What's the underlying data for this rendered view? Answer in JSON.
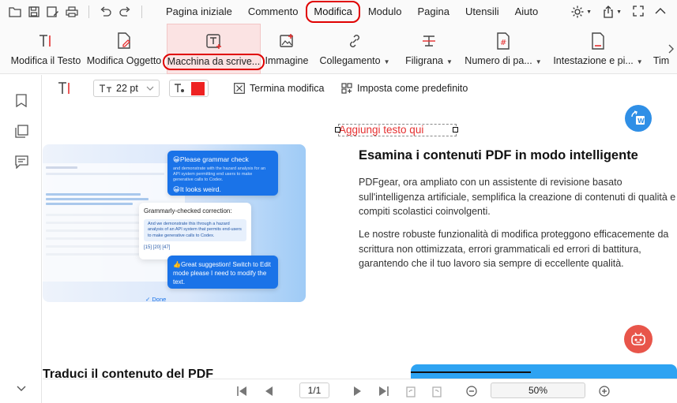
{
  "menu": {
    "items": [
      "Pagina iniziale",
      "Commento",
      "Modifica",
      "Modulo",
      "Pagina",
      "Utensili",
      "Aiuto"
    ],
    "active_index": 2
  },
  "ribbon": {
    "tools": [
      {
        "label": "Modifica il Testo",
        "icon": "edit-text-icon"
      },
      {
        "label": "Modifica Oggetto",
        "icon": "edit-object-icon"
      },
      {
        "label": "Macchina da scrive...",
        "icon": "typewriter-icon"
      },
      {
        "label": "Immagine",
        "icon": "image-icon"
      },
      {
        "label": "Collegamento",
        "icon": "link-icon",
        "caret": true
      },
      {
        "label": "Filigrana",
        "icon": "watermark-icon",
        "caret": true
      },
      {
        "label": "Numero di pa...",
        "icon": "page-number-icon",
        "caret": true
      },
      {
        "label": "Intestazione e pi...",
        "icon": "header-footer-icon",
        "caret": true
      },
      {
        "label": "Tim",
        "icon": "more-icon"
      }
    ]
  },
  "subbar": {
    "font_size": "22 pt",
    "text_color": "#ee2222",
    "finish_label": "Termina modifica",
    "default_label": "Imposta come predefinito"
  },
  "document": {
    "add_text_placeholder": "Aggiungi testo qui",
    "heading": "Esamina i contenuti PDF in modo intelligente",
    "para1": "PDFgear, ora ampliato con un assistente di revisione basato sull'intelligenza artificiale, semplifica la creazione di contenuti di qualità e compiti scolastici coinvolgenti.",
    "para2": "Le nostre robuste funzionalità di modifica proteggono efficacemente da scrittura non ottimizzata, errori grammaticali ed errori di battitura, garantendo che il tuo lavoro sia sempre di eccellente qualità.",
    "bottom_heading": "Traduci il contenuto del PDF",
    "hero": {
      "bubble1_title": "😀Please grammar check",
      "bubble1_small": "and demonstrate with the hazard analysis for an API system permitting end users to make generative calls to Codex.",
      "bubble1_footer": "😀It looks weird.",
      "card_title": "Grammarly-checked correction:",
      "card_text": "And we demonstrate this through a hazard analysis of an API system that permits end-users to make generative calls to Codex.",
      "card_refs": "[15] [20] [47]",
      "bubble2": "👍Great suggestion! Switch to Edit mode please I need to modify the text.",
      "done": "✓ Done"
    }
  },
  "navbar": {
    "page": "1/1",
    "zoom": "50%"
  }
}
